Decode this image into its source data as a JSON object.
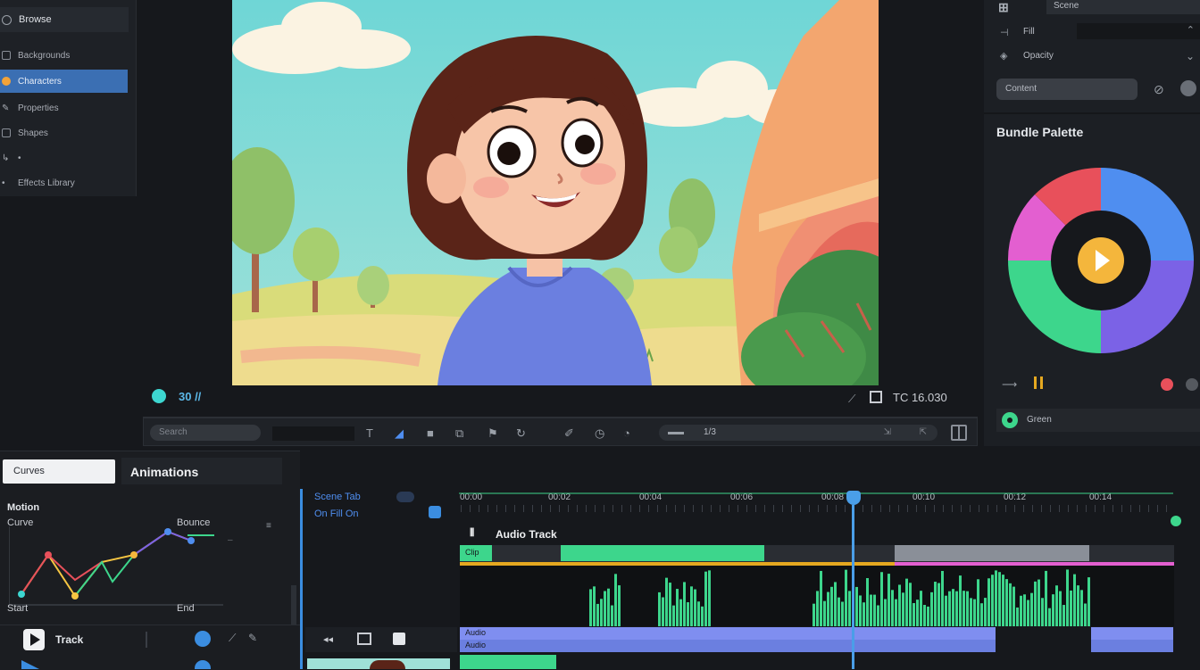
{
  "left_panel": {
    "header": "Browse",
    "items": [
      {
        "label": "Backgrounds",
        "active": false
      },
      {
        "label": "Characters",
        "active": true
      },
      {
        "label": "Properties",
        "active": false
      },
      {
        "label": "Shapes",
        "active": false
      },
      {
        "label": "•",
        "active": false
      },
      {
        "label": "Effects Library",
        "active": false
      }
    ]
  },
  "transport": {
    "fps_label": "30 //",
    "timecode": "TC 16.030"
  },
  "toolbar": {
    "search_placeholder": "Search",
    "field_value": "1/3"
  },
  "right_panel": {
    "top_label": "Scene",
    "row1_label": "Fill",
    "row2_label": "Opacity",
    "dropdown_label": "Content",
    "color_title": "Bundle Palette",
    "footer_label": "Green"
  },
  "bottom_left": {
    "tab_active": "Curves",
    "tab_title": "Animations",
    "graph_title": "Motion",
    "graph_subtitle": "Curve",
    "graph_right_label": "Bounce",
    "graph_bottom_left": "Start",
    "graph_bottom_right": "End",
    "play_label": "Track"
  },
  "timeline": {
    "header_line1": "Scene Tab",
    "header_line2": "On Fill On",
    "track_title": "Audio Track",
    "ruler": [
      "00:00",
      "00:02",
      "00:04",
      "00:06",
      "00:08",
      "00:10",
      "00:12",
      "00:14"
    ],
    "clip_label": "Clip",
    "lane1_label": "Audio",
    "lane2_label": "Audio"
  },
  "colors": {
    "accent_blue": "#3b6fb3",
    "playhead": "#4a9ee8",
    "audio_green": "#3dd68c",
    "wheel_red": "#e8505b",
    "wheel_blue": "#4f8ef0",
    "wheel_purple": "#7b62e6",
    "wheel_green": "#3dd68c",
    "wheel_pink": "#e35fd0",
    "wheel_play": "#f4b63c"
  }
}
